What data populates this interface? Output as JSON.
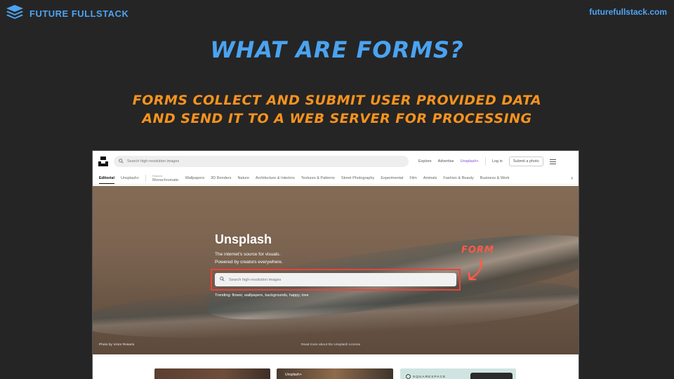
{
  "slide": {
    "brand_name": "FUTURE FULLSTACK",
    "site_url": "futurefullstack.com",
    "title": "WHAT ARE FORMS?",
    "subtitle_line1": "FORMS COLLECT AND SUBMIT USER PROVIDED DATA",
    "subtitle_line2": "AND SEND IT TO A WEB SERVER FOR PROCESSING",
    "annotation_label": "FORM"
  },
  "colors": {
    "brand_blue": "#4ea3f2",
    "subtitle_orange": "#f7931e",
    "annotation_red": "#e8443a",
    "background": "#252525"
  },
  "screenshot": {
    "topbar": {
      "search_placeholder": "Search high-resolution images",
      "nav_explore": "Explore",
      "nav_advertise": "Advertise",
      "nav_plus": "Unsplash+",
      "login": "Log in",
      "submit_photo": "Submit a photo"
    },
    "categories": {
      "editorial": "Editorial",
      "unsplash_plus": "Unsplash+",
      "featured_caption": "Featured",
      "items": [
        "Monochromatic",
        "Wallpapers",
        "3D Renders",
        "Nature",
        "Architecture & Interiors",
        "Textures & Patterns",
        "Street Photography",
        "Experimental",
        "Film",
        "Animals",
        "Fashion & Beauty",
        "Business & Work"
      ]
    },
    "hero": {
      "title": "Unsplash",
      "desc_line1": "The internet's source for visuals.",
      "desc_line2": "Powered by creators everywhere.",
      "search_placeholder": "Search high-resolution images",
      "trending": "Trending: flower, wallpapers, backgrounds, happy, love",
      "photo_credit": "Photo by Victor Rosario",
      "license_note": "Read more about the Unsplash License"
    },
    "thumbs": {
      "plus_tag": "Unsplash+",
      "squarespace": "SQUARESPACE"
    }
  },
  "icons": {
    "brand": "stacked-layers-icon",
    "search": "search-icon",
    "menu": "hamburger-menu-icon",
    "chevron": "chevron-right-icon",
    "arrow": "curved-arrow-icon"
  }
}
